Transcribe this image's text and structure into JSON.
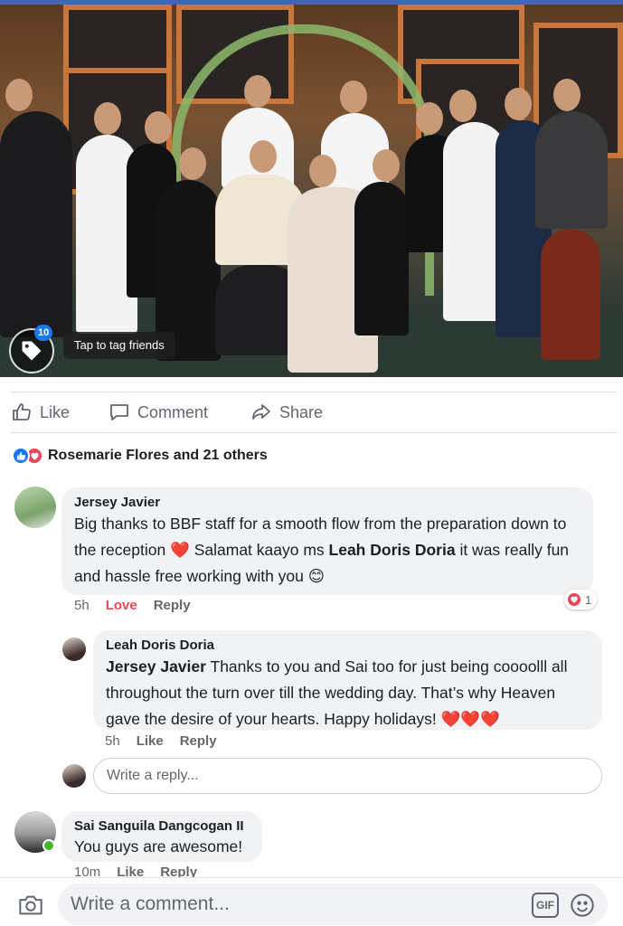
{
  "photo": {
    "tag_count": "10",
    "tag_tooltip": "Tap to tag friends"
  },
  "actions": {
    "like": "Like",
    "comment": "Comment",
    "share": "Share"
  },
  "reactions": {
    "summary": "Rosemarie Flores and 21 others",
    "icons": [
      "like-icon",
      "love-icon"
    ]
  },
  "comments": [
    {
      "author": "Jersey Javier",
      "text_before": "Big thanks to BBF staff for a smooth flow from the preparation down to the reception",
      "text_middle": " Salamat kaayo ms ",
      "mention": "Leah Doris Doria",
      "text_after": " it was really fun and hassle free working with you",
      "time": "5h",
      "love_label": "Love",
      "reply_label": "Reply",
      "reaction_count": "1"
    },
    {
      "author": "Leah Doris Doria",
      "mention": "Jersey Javier",
      "text": " Thanks to you and Sai too for just being coooolll all throughout the turn over till the wedding day. That’s why Heaven gave the desire of your hearts. Happy holidays!",
      "time": "5h",
      "like_label": "Like",
      "reply_label": "Reply"
    },
    {
      "author": "Sai Sanguila Dangcogan II",
      "text": "You guys are awesome!",
      "time": "10m",
      "like_label": "Like",
      "reply_label": "Reply"
    }
  ],
  "reply_input": {
    "placeholder": "Write a reply..."
  },
  "comment_input": {
    "placeholder": "Write a comment..."
  },
  "bottom_icons": [
    "camera-icon",
    "gif-icon",
    "emoji-icon"
  ],
  "colors": {
    "brand": "#4267b2",
    "like_blue": "#1877f2",
    "love_red": "#e9455a",
    "bubble": "#f0f2f5"
  }
}
